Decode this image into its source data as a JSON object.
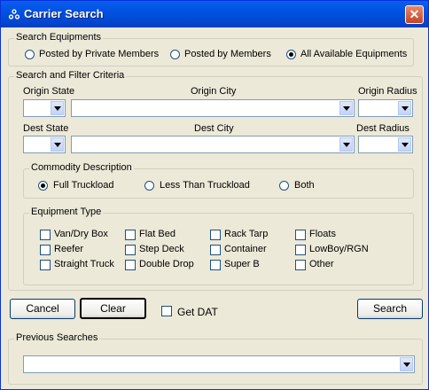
{
  "window": {
    "title": "Carrier Search",
    "close_symbol": "✕"
  },
  "search_equipments": {
    "legend": "Search Equipments",
    "options": [
      "Posted by Private Members",
      "Posted by Members",
      "All Available Equipments"
    ],
    "selected": "All Available Equipments"
  },
  "criteria": {
    "legend": "Search and Filter Criteria",
    "origin_state_label": "Origin State",
    "origin_city_label": "Origin City",
    "origin_radius_label": "Origin Radius",
    "dest_state_label": "Dest State",
    "dest_city_label": "Dest City",
    "dest_radius_label": "Dest Radius",
    "origin_state_value": "",
    "origin_city_value": "",
    "origin_radius_value": "",
    "dest_state_value": "",
    "dest_city_value": "",
    "dest_radius_value": ""
  },
  "commodity": {
    "legend": "Commodity Description",
    "options": [
      "Full Truckload",
      "Less Than Truckload",
      "Both"
    ],
    "selected": "Full Truckload"
  },
  "equipment": {
    "legend": "Equipment Type",
    "items": [
      "Van/Dry Box",
      "Flat Bed",
      "Rack Tarp",
      "Floats",
      "Reefer",
      "Step Deck",
      "Container",
      "LowBoy/RGN",
      "Straight Truck",
      "Double Drop",
      "Super B",
      "Other"
    ]
  },
  "actions": {
    "cancel": "Cancel",
    "clear": "Clear",
    "get_dat": "Get DAT",
    "search": "Search"
  },
  "previous": {
    "legend": "Previous Searches",
    "value": ""
  }
}
